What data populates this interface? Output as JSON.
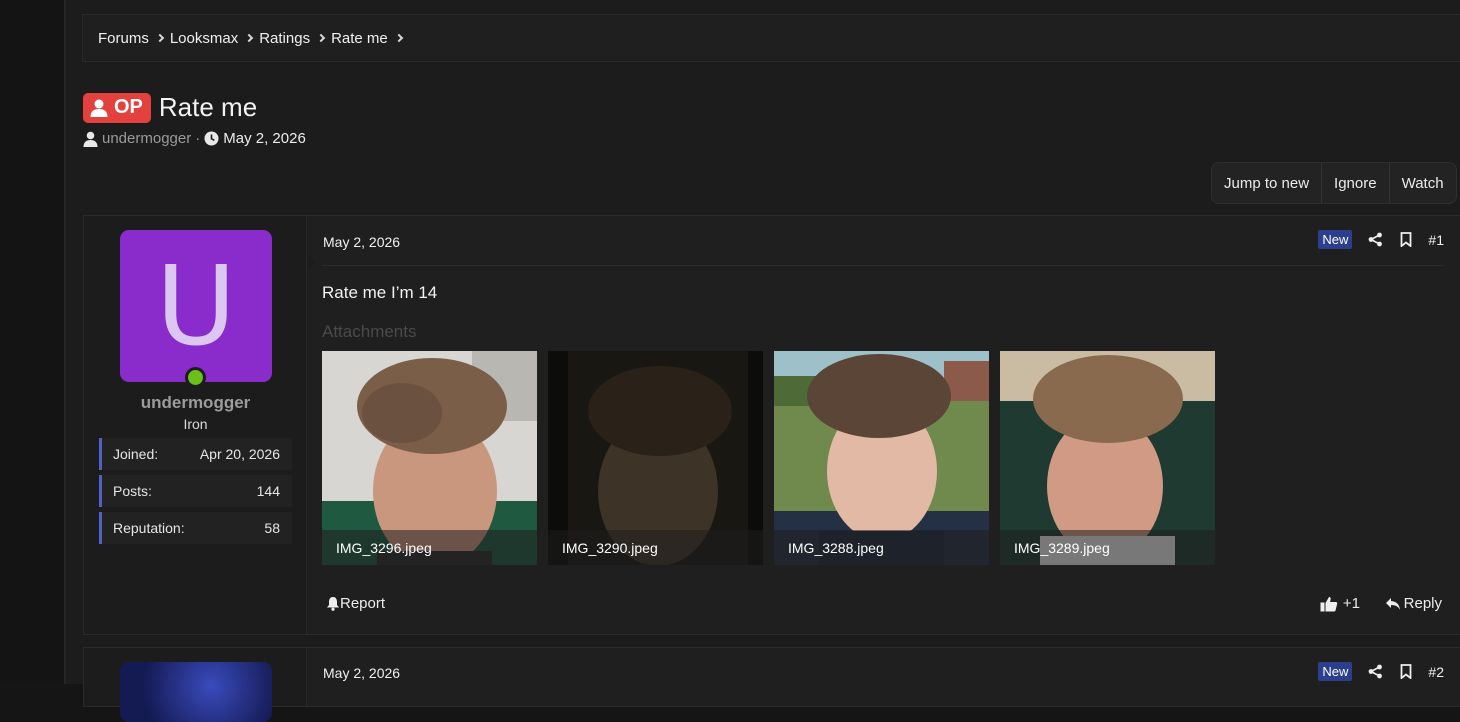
{
  "breadcrumb": [
    "Forums",
    "Looksmax",
    "Ratings",
    "Rate me"
  ],
  "thread": {
    "prefix": "OP",
    "title": "Rate me",
    "author": "undermogger",
    "separator": "·",
    "date": "May 2, 2026",
    "actions": [
      "Jump to new",
      "Ignore",
      "Watch"
    ]
  },
  "posts": [
    {
      "avatar_letter": "U",
      "avatar_color": "#8a2ccc",
      "username": "undermogger",
      "user_title": "Iron",
      "stats": [
        {
          "label": "Joined:",
          "value": "Apr 20, 2026"
        },
        {
          "label": "Posts:",
          "value": "144"
        },
        {
          "label": "Reputation:",
          "value": "58"
        }
      ],
      "date": "May 2, 2026",
      "badge": "New",
      "number": "#1",
      "body": "Rate me I’m 14",
      "attachments_label": "Attachments",
      "attachments": [
        "IMG_3296.jpeg",
        "IMG_3290.jpeg",
        "IMG_3288.jpeg",
        "IMG_3289.jpeg"
      ],
      "report_label": "Report",
      "like_count": "+1",
      "reply_label": "Reply"
    },
    {
      "date": "May 2, 2026",
      "badge": "New",
      "number": "#2"
    }
  ]
}
